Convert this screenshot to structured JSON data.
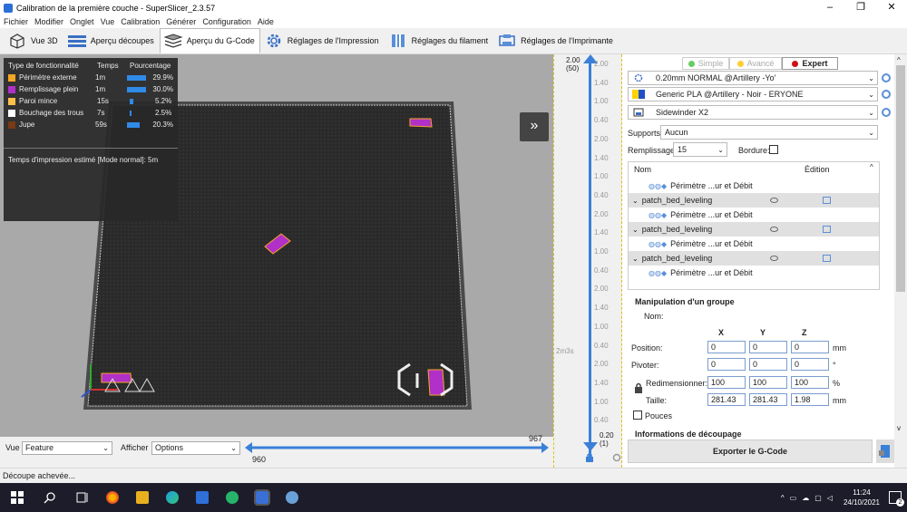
{
  "window": {
    "title": "Calibration de la première couche - SuperSlicer_2.3.57",
    "controls": [
      "–",
      "❐",
      "✕"
    ]
  },
  "menu": [
    "Fichier",
    "Modifier",
    "Onglet",
    "Vue",
    "Calibration",
    "Générer",
    "Configuration",
    "Aide"
  ],
  "tabs": [
    {
      "label": "Vue 3D",
      "icon": "cube-icon"
    },
    {
      "label": "Aperçu découpes",
      "icon": "layers-icon"
    },
    {
      "label": "Aperçu du G-Code",
      "icon": "layers-icon"
    },
    {
      "label": "Réglages de l'Impression",
      "icon": "gear-icon"
    },
    {
      "label": "Réglages du filament",
      "icon": "spool-icon"
    },
    {
      "label": "Réglages de l'Imprimante",
      "icon": "printer-icon"
    }
  ],
  "legend": {
    "header": {
      "type": "Type de fonctionnalité",
      "time": "Temps",
      "pct": "Pourcentage"
    },
    "rows": [
      {
        "label": "Périmètre externe",
        "time": "1m",
        "pct": "29.9%",
        "color": "#f5a623",
        "fill": 0.299
      },
      {
        "label": "Remplissage plein",
        "time": "1m",
        "pct": "30.0%",
        "color": "#b030c8",
        "fill": 0.3
      },
      {
        "label": "Paroi mince",
        "time": "15s",
        "pct": "5.2%",
        "color": "#ffc04a",
        "fill": 0.052
      },
      {
        "label": "Bouchage des trous",
        "time": "7s",
        "pct": "2.5%",
        "color": "#ffffff",
        "fill": 0.025
      },
      {
        "label": "Jupe",
        "time": "59s",
        "pct": "20.3%",
        "color": "#7a3a14",
        "fill": 0.203
      }
    ],
    "estimate": "Temps d'impression estimé [Mode normal]:  5m"
  },
  "hslider": {
    "view_label": "Vue",
    "view_value": "Feature",
    "show_label": "Afficher",
    "show_value": "Options",
    "top_value": "967",
    "bottom_value": "960"
  },
  "vslider": {
    "top_value": "2.00",
    "top_layer": "(50)",
    "bottom_value": "0.20",
    "bottom_layer": "(1)",
    "time_label": "2m3s",
    "ticks": [
      "2.00",
      "1.40",
      "1.00",
      "0.40",
      "2.00",
      "1.40",
      "1.00",
      "0.40",
      "2.00",
      "1.40",
      "1.00",
      "0.40",
      "2.00",
      "1.40",
      "1.00",
      "0.40",
      "2.00",
      "1.40",
      "1.00",
      "0.40"
    ]
  },
  "panel": {
    "modes": {
      "simple": "Simple",
      "advanced": "Avancé",
      "expert": "Expert"
    },
    "print_profile": "0.20mm NORMAL @Artillery -Yo'",
    "filament_profile": "Generic PLA @Artillery - Noir - ERYONE",
    "printer_profile": "Sidewinder X2",
    "supports_label": "Supports:",
    "supports_value": "Aucun",
    "infill_label": "Remplissage:",
    "infill_value": "15",
    "brim_label": "Bordure:",
    "list_headers": {
      "name": "Nom",
      "edit": "Édition"
    },
    "list_rows": [
      {
        "text": "Périmètre ...ur et Débit",
        "kind": "child"
      },
      {
        "text": "patch_bed_leveling",
        "kind": "parent"
      },
      {
        "text": "Périmètre ...ur et Débit",
        "kind": "child"
      },
      {
        "text": "patch_bed_leveling",
        "kind": "parent"
      },
      {
        "text": "Périmètre ...ur et Débit",
        "kind": "child"
      },
      {
        "text": "patch_bed_leveling",
        "kind": "parent"
      },
      {
        "text": "Périmètre ...ur et Débit",
        "kind": "child"
      }
    ],
    "manip": {
      "title": "Manipulation d'un groupe",
      "name_label": "Nom:",
      "axes": [
        "X",
        "Y",
        "Z"
      ],
      "position_label": "Position:",
      "position": [
        "0",
        "0",
        "0"
      ],
      "position_unit": "mm",
      "rotate_label": "Pivoter:",
      "rotate": [
        "0",
        "0",
        "0"
      ],
      "rotate_unit": "°",
      "scale_label": "Redimensionner:",
      "scale": [
        "100",
        "100",
        "100"
      ],
      "scale_unit": "%",
      "size_label": "Taille:",
      "size": [
        "281.43",
        "281.43",
        "1.98"
      ],
      "size_unit": "mm",
      "inches_label": "Pouces"
    },
    "slice_info": "Informations de découpage",
    "export_label": "Exporter le G-Code"
  },
  "status": "Découpe achevée...",
  "taskbar": {
    "time": "11:24",
    "date": "24/10/2021",
    "notif_count": "2"
  }
}
